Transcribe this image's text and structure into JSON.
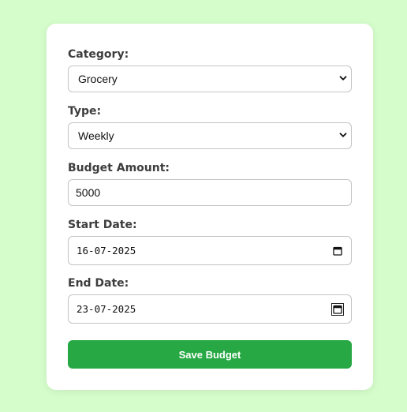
{
  "form": {
    "category": {
      "label": "Category:",
      "selected": "Grocery",
      "icon": "chevron-down-icon"
    },
    "type": {
      "label": "Type:",
      "selected": "Weekly",
      "icon": "chevron-down-icon"
    },
    "budget_amount": {
      "label": "Budget Amount:",
      "value": "5000"
    },
    "start_date": {
      "label": "Start Date:",
      "value": "16-07-2025",
      "icon": "calendar-icon"
    },
    "end_date": {
      "label": "End Date:",
      "value": "23-07-2025",
      "icon": "calendar-icon"
    },
    "save_label": "Save Budget"
  },
  "colors": {
    "page_background": "#d5fdcb",
    "card_background": "#ffffff",
    "button_background": "#27a844",
    "button_text": "#ffffff",
    "label_text": "#3d3d3d",
    "input_border": "#c4c4c4"
  }
}
